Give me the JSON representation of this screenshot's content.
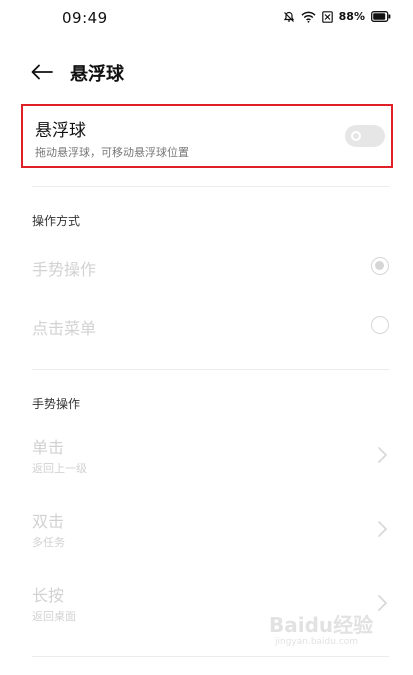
{
  "status_bar": {
    "time": "09:49",
    "battery_percent": "88%",
    "icons": [
      "mute-icon",
      "wifi-icon",
      "sim-icon",
      "battery-icon"
    ]
  },
  "header": {
    "back_icon": "arrow-left-icon",
    "title": "悬浮球"
  },
  "floating_ball": {
    "title": "悬浮球",
    "subtitle": "拖动悬浮球，可移动悬浮球位置",
    "enabled": false
  },
  "operation_mode": {
    "section_label": "操作方式",
    "options": [
      {
        "label": "手势操作",
        "selected": true
      },
      {
        "label": "点击菜单",
        "selected": false
      }
    ]
  },
  "gesture": {
    "section_label": "手势操作",
    "items": [
      {
        "title": "单击",
        "subtitle": "返回上一级"
      },
      {
        "title": "双击",
        "subtitle": "多任务"
      },
      {
        "title": "长按",
        "subtitle": "返回桌面"
      }
    ]
  },
  "watermark": {
    "logo": "Baidu经验",
    "url": "jingyan.baidu.com"
  },
  "colors": {
    "highlight_border": "#e01f26",
    "disabled_text": "#d2d2d2",
    "toggle_off": "#e6e6e6"
  }
}
